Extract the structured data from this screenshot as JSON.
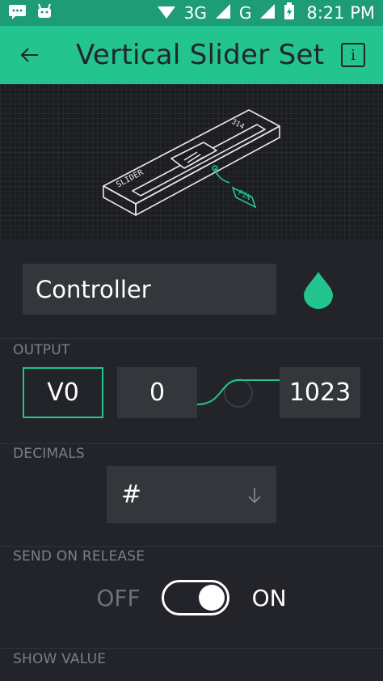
{
  "status_bar": {
    "network_3g": "3G",
    "network_g": "G",
    "time": "8:21 PM"
  },
  "app_bar": {
    "title": "Vertical Slider Set",
    "info_label": "i"
  },
  "illustration": {
    "slider_label": "SLIDER",
    "slider_value": "314",
    "pin_label": "PIN"
  },
  "name_field": {
    "value": "Controller",
    "color": "#23c48e"
  },
  "output": {
    "label": "OUTPUT",
    "pin": "V0",
    "min": "0",
    "max": "1023"
  },
  "decimals": {
    "label": "DECIMALS",
    "value": "#"
  },
  "send_on_release": {
    "label": "SEND ON RELEASE",
    "off_label": "OFF",
    "on_label": "ON",
    "state": "ON"
  },
  "show_value": {
    "label": "SHOW VALUE"
  },
  "colors": {
    "accent": "#23c48e",
    "status_bar": "#1e9c76",
    "background": "#222429",
    "field": "#33363b",
    "label": "#7b7f86"
  }
}
